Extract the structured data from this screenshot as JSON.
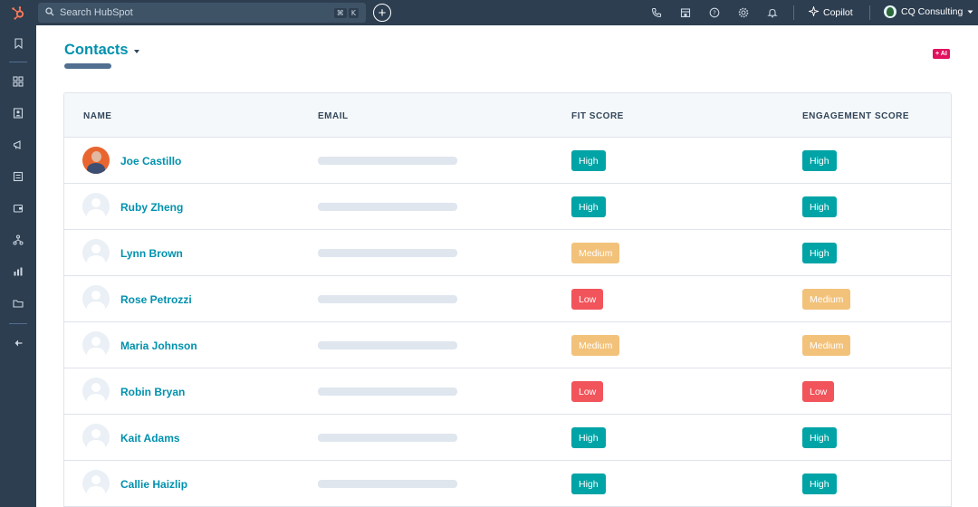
{
  "colors": {
    "nav_bg": "#2d3e50",
    "link": "#0091ae",
    "high": "#00a4a6",
    "medium": "#f2c27b",
    "low": "#f2545b",
    "ai_badge": "#e0115f"
  },
  "topbar": {
    "search_placeholder": "Search HubSpot",
    "shortcut_keys": [
      "⌘",
      "K"
    ],
    "icons": [
      "phone-icon",
      "marketplace-icon",
      "help-icon",
      "settings-icon",
      "notifications-icon"
    ],
    "copilot_label": "Copilot",
    "account_name": "CQ Consulting"
  },
  "sidebar": {
    "icons": [
      "bookmark-icon",
      "workspaces-icon",
      "contacts-icon",
      "marketing-icon",
      "content-icon",
      "commerce-icon",
      "automation-icon",
      "reporting-icon",
      "library-icon",
      "collapse-icon"
    ]
  },
  "page": {
    "title": "Contacts",
    "ai_badge": "+ AI"
  },
  "table": {
    "headers": {
      "name": "NAME",
      "email": "EMAIL",
      "fit": "FIT SCORE",
      "engagement": "ENGAGEMENT SCORE"
    },
    "rows": [
      {
        "name": "Joe Castillo",
        "fit": "High",
        "engagement": "High",
        "has_photo": true
      },
      {
        "name": "Ruby Zheng",
        "fit": "High",
        "engagement": "High",
        "has_photo": false
      },
      {
        "name": "Lynn Brown",
        "fit": "Medium",
        "engagement": "High",
        "has_photo": false
      },
      {
        "name": "Rose Petrozzi",
        "fit": "Low",
        "engagement": "Medium",
        "has_photo": false
      },
      {
        "name": "Maria Johnson",
        "fit": "Medium",
        "engagement": "Medium",
        "has_photo": false
      },
      {
        "name": "Robin Bryan",
        "fit": "Low",
        "engagement": "Low",
        "has_photo": false
      },
      {
        "name": "Kait Adams",
        "fit": "High",
        "engagement": "High",
        "has_photo": false
      },
      {
        "name": "Callie Haizlip",
        "fit": "High",
        "engagement": "High",
        "has_photo": false
      }
    ]
  }
}
